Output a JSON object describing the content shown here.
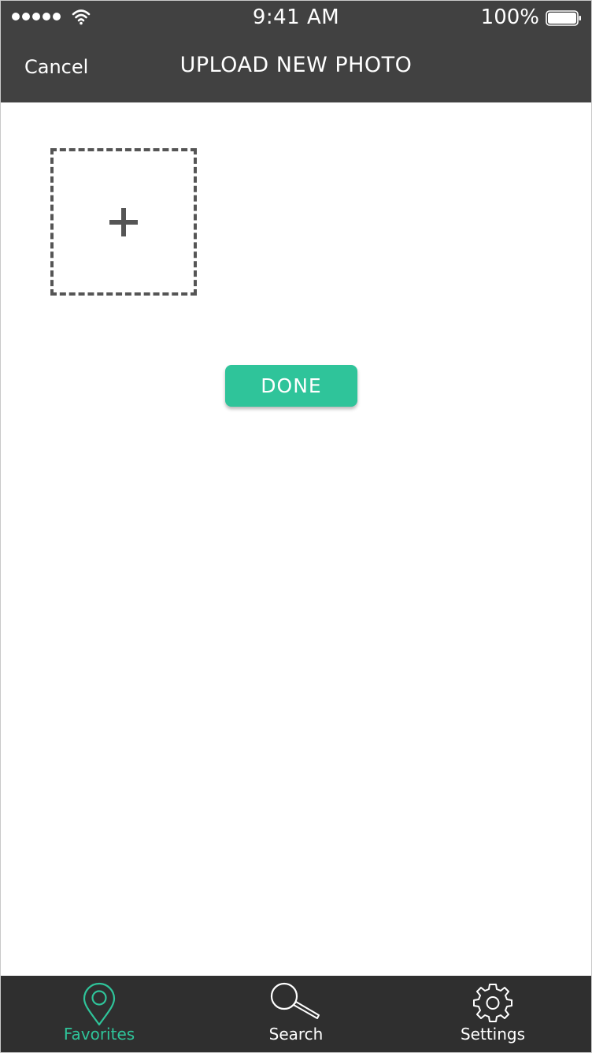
{
  "status_bar": {
    "time": "9:41 AM",
    "battery_percent": "100%",
    "signal_bars": 5,
    "battery_level": 1.0
  },
  "header": {
    "cancel_label": "Cancel",
    "title": "UPLOAD NEW PHOTO"
  },
  "upload": {
    "add_icon": "plus-icon"
  },
  "actions": {
    "done_label": "DONE"
  },
  "tabbar": {
    "items": [
      {
        "label": "Favorites",
        "icon": "map-pin-icon",
        "active": true
      },
      {
        "label": "Search",
        "icon": "magnifier-icon",
        "active": false
      },
      {
        "label": "Settings",
        "icon": "gear-icon",
        "active": false
      }
    ]
  },
  "colors": {
    "header_bg": "#414141",
    "tabbar_bg": "#2f2f2f",
    "accent": "#2fc49a",
    "dashed_border": "#555555"
  }
}
